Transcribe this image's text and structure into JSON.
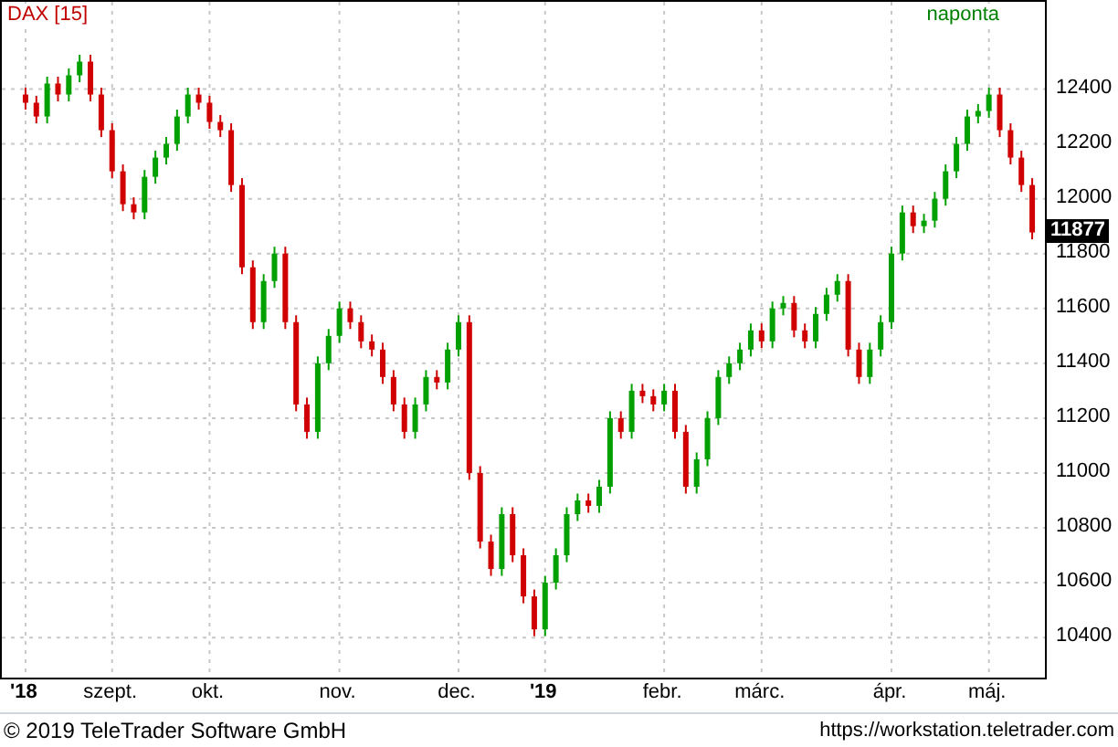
{
  "header": {
    "symbol": "DAX [15]",
    "interval": "naponta"
  },
  "chart": {
    "last_price": "11877",
    "chart_data": {
      "type": "candlestick",
      "grid": true,
      "ylim": [
        10254,
        12718
      ],
      "yticks": [
        10400,
        10600,
        10800,
        11000,
        11200,
        11400,
        11600,
        11800,
        12000,
        12200,
        12400
      ],
      "categories": [
        "'18",
        null,
        null,
        null,
        null,
        null,
        null,
        null,
        "szept.",
        null,
        null,
        null,
        null,
        null,
        null,
        null,
        null,
        "okt.",
        null,
        null,
        null,
        null,
        null,
        null,
        null,
        null,
        null,
        null,
        null,
        "nov.",
        null,
        null,
        null,
        null,
        null,
        null,
        null,
        null,
        null,
        null,
        "dec.",
        null,
        null,
        null,
        null,
        null,
        null,
        null,
        "'19",
        null,
        null,
        null,
        null,
        null,
        null,
        null,
        null,
        null,
        null,
        "febr.",
        null,
        null,
        null,
        null,
        null,
        null,
        null,
        null,
        "márc.",
        null,
        null,
        null,
        null,
        null,
        null,
        null,
        null,
        null,
        null,
        null,
        "ápr.",
        null,
        null,
        null,
        null,
        null,
        null,
        null,
        null,
        "máj.",
        null,
        null,
        null,
        null
      ],
      "ohlc": [
        [
          12380,
          12405,
          12325,
          12350
        ],
        [
          12350,
          12375,
          12275,
          12300
        ],
        [
          12300,
          12445,
          12275,
          12420
        ],
        [
          12420,
          12445,
          12355,
          12380
        ],
        [
          12380,
          12475,
          12355,
          12450
        ],
        [
          12450,
          12525,
          12425,
          12500
        ],
        [
          12500,
          12525,
          12355,
          12380
        ],
        [
          12380,
          12405,
          12225,
          12250
        ],
        [
          12250,
          12275,
          12075,
          12100
        ],
        [
          12100,
          12125,
          11955,
          11980
        ],
        [
          11980,
          12005,
          11925,
          11950
        ],
        [
          11950,
          12105,
          11925,
          12080
        ],
        [
          12080,
          12175,
          12055,
          12150
        ],
        [
          12150,
          12225,
          12125,
          12200
        ],
        [
          12200,
          12325,
          12175,
          12300
        ],
        [
          12300,
          12405,
          12275,
          12380
        ],
        [
          12380,
          12405,
          12325,
          12350
        ],
        [
          12350,
          12375,
          12255,
          12280
        ],
        [
          12280,
          12305,
          12225,
          12250
        ],
        [
          12250,
          12275,
          12025,
          12050
        ],
        [
          12050,
          12075,
          11725,
          11750
        ],
        [
          11750,
          11775,
          11525,
          11550
        ],
        [
          11550,
          11725,
          11525,
          11700
        ],
        [
          11700,
          11825,
          11675,
          11800
        ],
        [
          11800,
          11825,
          11525,
          11550
        ],
        [
          11550,
          11575,
          11225,
          11250
        ],
        [
          11250,
          11275,
          11125,
          11150
        ],
        [
          11150,
          11425,
          11125,
          11400
        ],
        [
          11400,
          11525,
          11375,
          11500
        ],
        [
          11500,
          11625,
          11475,
          11600
        ],
        [
          11600,
          11625,
          11525,
          11550
        ],
        [
          11550,
          11575,
          11455,
          11480
        ],
        [
          11480,
          11505,
          11425,
          11450
        ],
        [
          11450,
          11475,
          11325,
          11350
        ],
        [
          11350,
          11375,
          11225,
          11250
        ],
        [
          11250,
          11275,
          11125,
          11150
        ],
        [
          11150,
          11275,
          11125,
          11250
        ],
        [
          11250,
          11375,
          11225,
          11350
        ],
        [
          11350,
          11375,
          11305,
          11330
        ],
        [
          11330,
          11475,
          11305,
          11450
        ],
        [
          11450,
          11575,
          11425,
          11550
        ],
        [
          11550,
          11575,
          10975,
          11000
        ],
        [
          11000,
          11025,
          10725,
          10750
        ],
        [
          10750,
          10775,
          10625,
          10650
        ],
        [
          10650,
          10875,
          10625,
          10850
        ],
        [
          10850,
          10875,
          10675,
          10700
        ],
        [
          10700,
          10725,
          10525,
          10550
        ],
        [
          10550,
          10575,
          10405,
          10430
        ],
        [
          10430,
          10625,
          10405,
          10600
        ],
        [
          10600,
          10725,
          10575,
          10700
        ],
        [
          10700,
          10875,
          10675,
          10850
        ],
        [
          10850,
          10925,
          10825,
          10900
        ],
        [
          10900,
          10925,
          10855,
          10880
        ],
        [
          10880,
          10975,
          10855,
          10950
        ],
        [
          10950,
          11225,
          10925,
          11200
        ],
        [
          11200,
          11225,
          11125,
          11150
        ],
        [
          11150,
          11325,
          11125,
          11300
        ],
        [
          11300,
          11325,
          11255,
          11280
        ],
        [
          11280,
          11305,
          11225,
          11250
        ],
        [
          11250,
          11325,
          11225,
          11300
        ],
        [
          11300,
          11325,
          11125,
          11150
        ],
        [
          11150,
          11175,
          10925,
          10950
        ],
        [
          10950,
          11075,
          10925,
          11050
        ],
        [
          11050,
          11225,
          11025,
          11200
        ],
        [
          11200,
          11375,
          11175,
          11350
        ],
        [
          11350,
          11425,
          11325,
          11400
        ],
        [
          11400,
          11475,
          11375,
          11450
        ],
        [
          11450,
          11545,
          11425,
          11520
        ],
        [
          11520,
          11545,
          11455,
          11480
        ],
        [
          11480,
          11625,
          11455,
          11600
        ],
        [
          11600,
          11645,
          11575,
          11620
        ],
        [
          11620,
          11645,
          11495,
          11520
        ],
        [
          11520,
          11545,
          11455,
          11480
        ],
        [
          11480,
          11605,
          11455,
          11580
        ],
        [
          11580,
          11675,
          11555,
          11650
        ],
        [
          11650,
          11725,
          11625,
          11700
        ],
        [
          11700,
          11725,
          11425,
          11450
        ],
        [
          11450,
          11475,
          11325,
          11350
        ],
        [
          11350,
          11475,
          11325,
          11450
        ],
        [
          11450,
          11575,
          11425,
          11550
        ],
        [
          11550,
          11825,
          11525,
          11800
        ],
        [
          11800,
          11975,
          11775,
          11950
        ],
        [
          11950,
          11975,
          11875,
          11900
        ],
        [
          11900,
          11945,
          11875,
          11920
        ],
        [
          11920,
          12025,
          11895,
          12000
        ],
        [
          12000,
          12125,
          11975,
          12100
        ],
        [
          12100,
          12225,
          12075,
          12200
        ],
        [
          12200,
          12325,
          12175,
          12300
        ],
        [
          12300,
          12345,
          12275,
          12320
        ],
        [
          12320,
          12405,
          12295,
          12380
        ],
        [
          12380,
          12405,
          12225,
          12250
        ],
        [
          12250,
          12275,
          12125,
          12150
        ],
        [
          12150,
          12175,
          12025,
          12050
        ],
        [
          12050,
          12075,
          11852,
          11877
        ]
      ]
    }
  },
  "footer": {
    "copyright": "© 2019 TeleTrader Software GmbH",
    "url": "https://workstation.teletrader.com"
  }
}
